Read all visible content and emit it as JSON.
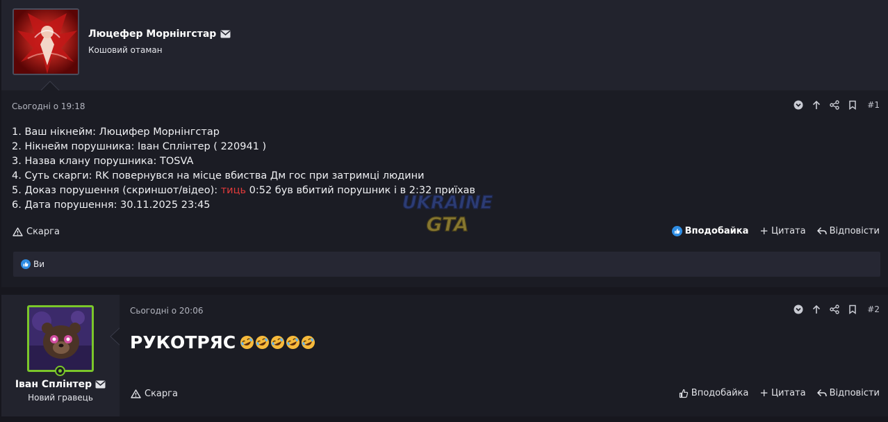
{
  "post1": {
    "author_name": "Люцефер Морнінгстар",
    "author_title": "Кошовий отаман",
    "date": "Сьогодні о 19:18",
    "post_number": "#1",
    "lines": [
      "1. Ваш нікнейм: Люцифер Морнінгстар",
      "2. Нікнейм порушника: Іван Сплінтер ( 220941 )",
      "3. Назва клану порушника: TOSVA",
      "4. Суть скарги: RK повернувся на місце вбиства Дм гос при затримці людини"
    ],
    "line5_prefix": "5. Доказ порушення (скриншот/відео): ",
    "line5_link": "тиць",
    "line5_suffix": " 0:52 був вбитий порушник і в 2:32 приїхав",
    "line6": "6. Дата порушення: 30.11.2025 23:45",
    "report_label": "Скарга",
    "like_label": "Вподобайка",
    "quote_label": "Цитата",
    "reply_label": "Відповісти",
    "likes_by": "Ви",
    "watermark_top": "UKRAINE",
    "watermark_bottom": "GTA"
  },
  "post2": {
    "author_name": "Іван Сплінтер",
    "author_title": "Новий гравець",
    "date": "Сьогодні о 20:06",
    "post_number": "#2",
    "text": "РУКОТРЯС",
    "report_label": "Скарга",
    "like_label": "Вподобайка",
    "quote_label": "Цитата",
    "reply_label": "Відповісти"
  },
  "colors": {
    "accent_green": "#7bc72a",
    "link_red": "#e13a3a",
    "like_blue": "#2f8de4"
  }
}
